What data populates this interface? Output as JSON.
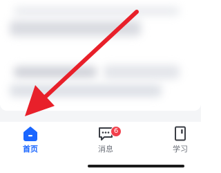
{
  "tabbar": {
    "tabs": [
      {
        "label": "首页",
        "icon": "home-icon",
        "active": true
      },
      {
        "label": "消息",
        "icon": "chat-icon",
        "badge": "6"
      },
      {
        "label": "学习",
        "icon": "book-icon"
      }
    ]
  },
  "colors": {
    "accent": "#1a66ff",
    "badge": "#f2404c",
    "annotation_arrow": "#e8202a"
  }
}
